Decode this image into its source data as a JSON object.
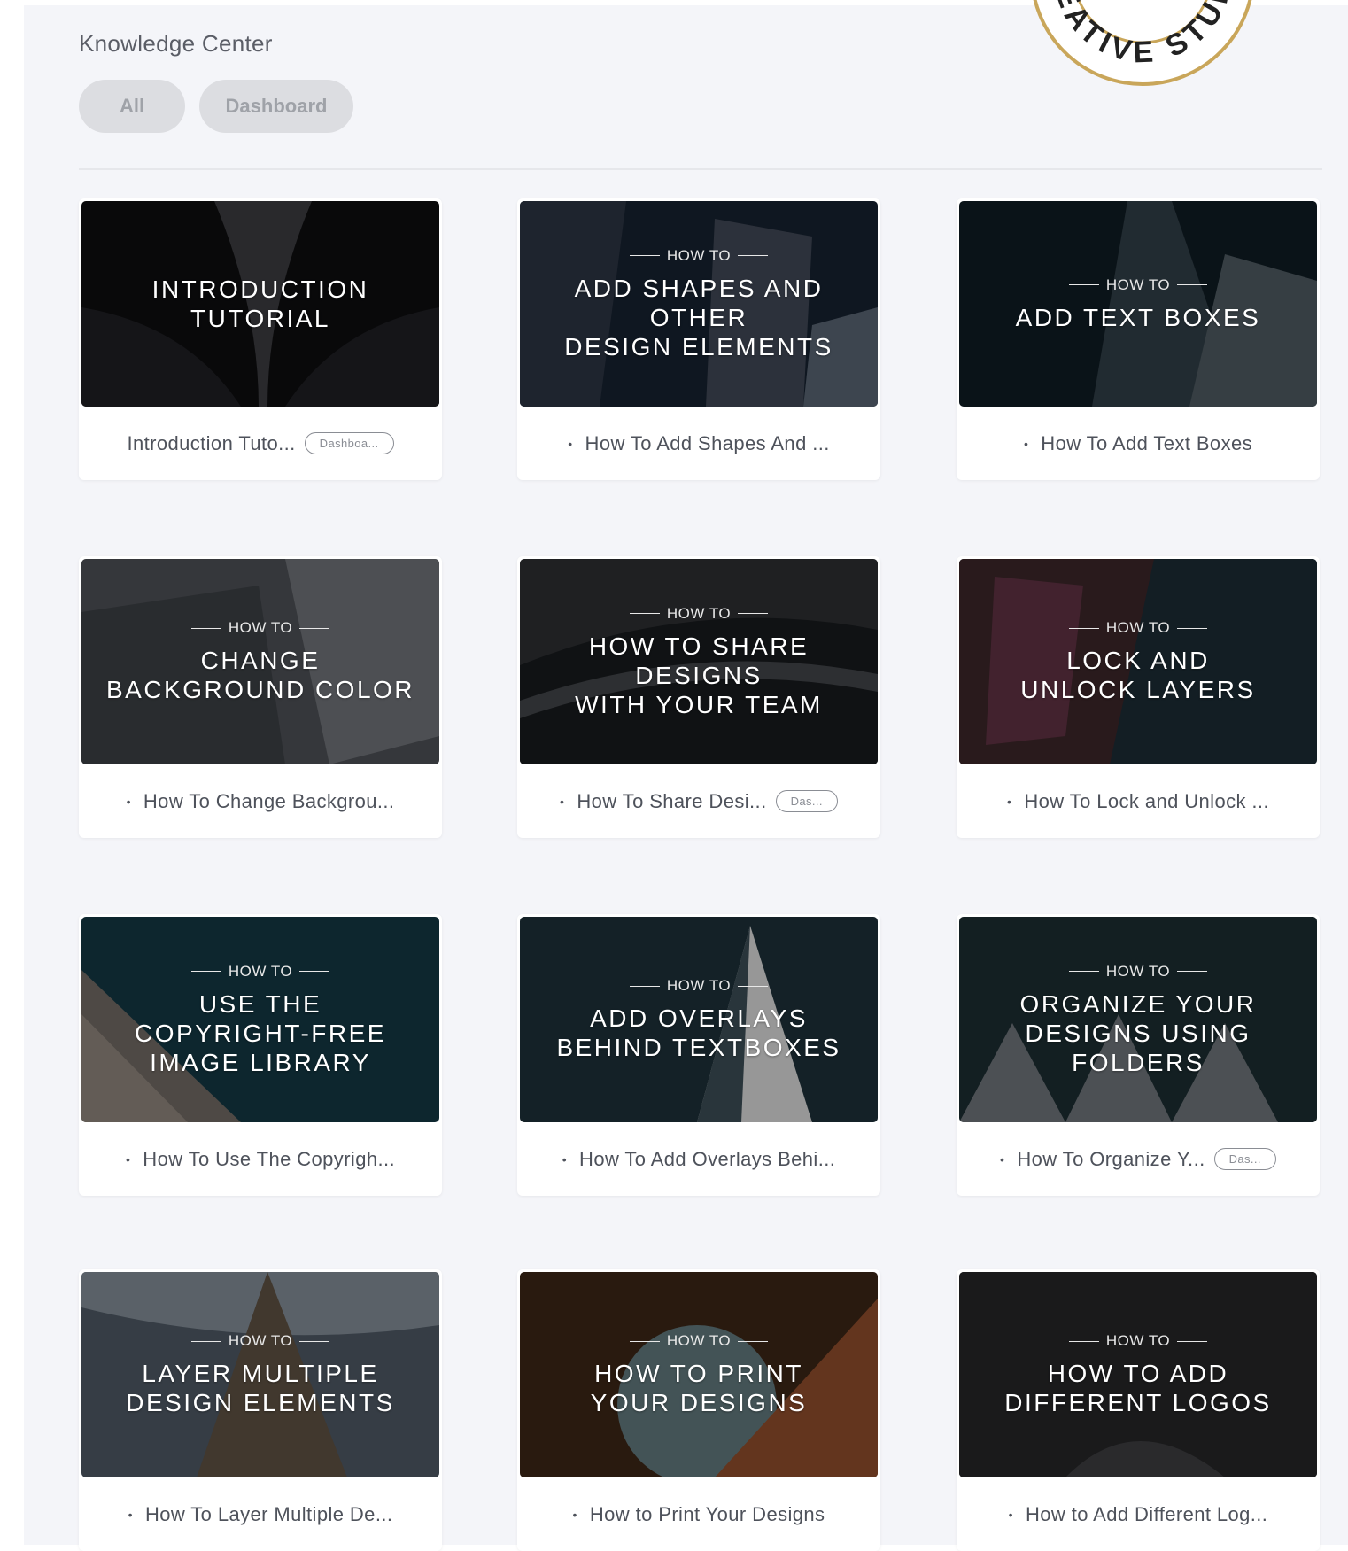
{
  "header": {
    "title": "Knowledge Center",
    "filters": [
      {
        "label": "All"
      },
      {
        "label": "Dashboard"
      }
    ]
  },
  "stamp": {
    "text": "CREATIVE STUDIO"
  },
  "cards": [
    {
      "howto": "",
      "title": "INTRODUCTION\nTUTORIAL",
      "caption": "Introduction Tuto...",
      "bullet": false,
      "tag": "Dashboa..."
    },
    {
      "howto": "HOW TO",
      "title": "ADD SHAPES AND OTHER\nDESIGN ELEMENTS",
      "caption": "How To Add Shapes And ...",
      "bullet": true,
      "tag": ""
    },
    {
      "howto": "HOW TO",
      "title": "ADD TEXT BOXES",
      "caption": "How To Add Text Boxes",
      "bullet": true,
      "tag": ""
    },
    {
      "howto": "HOW TO",
      "title": "CHANGE\nBACKGROUND COLOR",
      "caption": "How To Change Backgrou...",
      "bullet": true,
      "tag": ""
    },
    {
      "howto": "HOW TO",
      "title": "HOW TO SHARE DESIGNS\nWITH YOUR TEAM",
      "caption": "How To Share Desi...",
      "bullet": true,
      "tag": "Das..."
    },
    {
      "howto": "HOW TO",
      "title": "LOCK AND\nUNLOCK LAYERS",
      "caption": "How To Lock and Unlock ...",
      "bullet": true,
      "tag": ""
    },
    {
      "howto": "HOW TO",
      "title": "USE THE\nCOPYRIGHT-FREE\nIMAGE LIBRARY",
      "caption": "How To Use The Copyrigh...",
      "bullet": true,
      "tag": ""
    },
    {
      "howto": "HOW TO",
      "title": "ADD OVERLAYS\nBEHIND TEXTBOXES",
      "caption": "How To Add Overlays Behi...",
      "bullet": true,
      "tag": ""
    },
    {
      "howto": "HOW TO",
      "title": "ORGANIZE YOUR\nDESIGNS USING FOLDERS",
      "caption": "How To Organize Y...",
      "bullet": true,
      "tag": "Das..."
    },
    {
      "howto": "HOW TO",
      "title": "LAYER MULTIPLE\nDESIGN ELEMENTS",
      "caption": "How To Layer Multiple De...",
      "bullet": true,
      "tag": ""
    },
    {
      "howto": "HOW TO",
      "title": "HOW TO PRINT\nYOUR DESIGNS",
      "caption": "How to Print Your Designs",
      "bullet": true,
      "tag": ""
    },
    {
      "howto": "HOW TO",
      "title": "HOW TO ADD\nDIFFERENT LOGOS",
      "caption": "How to Add Different Log...",
      "bullet": true,
      "tag": ""
    }
  ],
  "colors": {
    "stamp_ring": "#c9a65a",
    "panel_bg": "#f4f5f9"
  }
}
